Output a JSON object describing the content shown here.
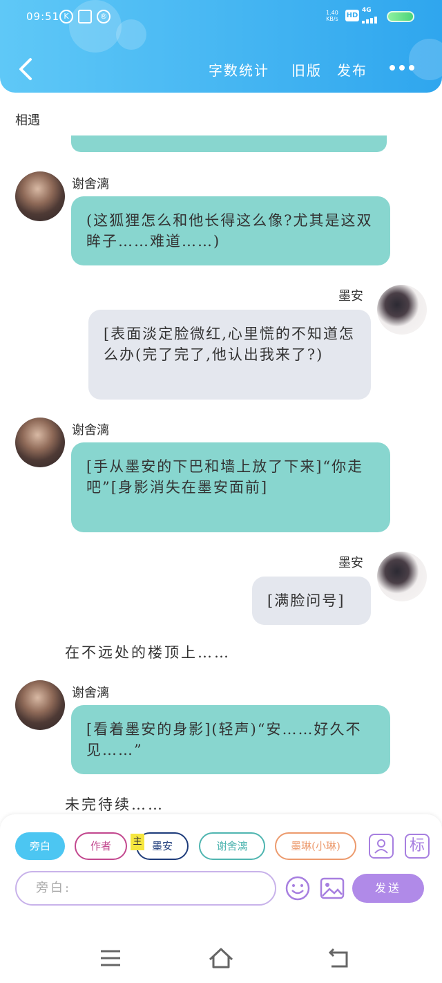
{
  "status_bar": {
    "time": "09:51",
    "left_icons": [
      "k-circle-icon",
      "image-icon",
      "r-circle-icon"
    ],
    "net_speed_value": "1.40",
    "net_speed_unit": "KB/s",
    "hd_label": "HD",
    "network_label": "4G"
  },
  "nav": {
    "back_icon": "chevron-left-icon",
    "word_count_label": "字数统计",
    "old_version_label": "旧版",
    "publish_label": "发布",
    "more_icon": "more-dots-icon"
  },
  "chat": {
    "title": "相遇",
    "messages": [
      {
        "speaker": "谢舍漓",
        "side": "left",
        "text": "(这狐狸怎么和他长得这么像?尤其是这双眸子……难道……)"
      },
      {
        "speaker": "墨安",
        "side": "right",
        "text": "[表面淡定脸微红,心里慌的不知道怎么办(完了完了,他认出我来了?)"
      },
      {
        "speaker": "谢舍漓",
        "side": "left",
        "text": "[手从墨安的下巴和墙上放了下来]“你走吧”[身影消失在墨安面前]"
      },
      {
        "speaker": "墨安",
        "side": "right",
        "text": "[满脸问号]"
      },
      {
        "narration": "在不远处的楼顶上……"
      },
      {
        "speaker": "谢舍漓",
        "side": "left",
        "text": "[看着墨安的身影](轻声)“安……好久不见……”"
      },
      {
        "narration": "未完待续……"
      }
    ]
  },
  "composer": {
    "roles": [
      "旁白",
      "作者",
      "墨安",
      "谢舍漓",
      "墨琳(小琳)"
    ],
    "main_badge": "主",
    "input_placeholder": "旁白:",
    "send_label": "发送",
    "mark_label": "标",
    "icons": [
      "role-avatar-icon",
      "emoji-icon",
      "image-icon"
    ]
  },
  "system_nav": {
    "icons": [
      "menu-icon",
      "home-icon",
      "back-icon"
    ]
  },
  "colors": {
    "header_gradient_start": "#5fc8f7",
    "header_gradient_end": "#2fa6ee",
    "left_bubble": "#88d6cf",
    "right_bubble": "#e4e7ee",
    "send_button": "#b08ae8",
    "narration_chip": "#4cc6f2"
  }
}
